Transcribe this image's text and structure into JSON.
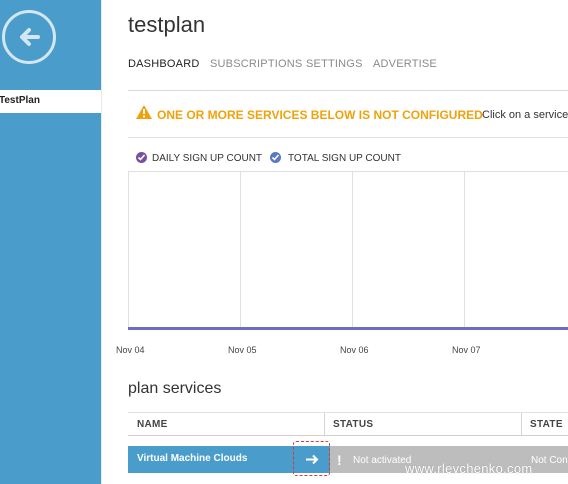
{
  "app": {
    "title": "testplan"
  },
  "sidebar": {
    "back_icon": "back-arrow-icon",
    "selected_item": "TestPlan"
  },
  "tabs": [
    {
      "label": "DASHBOARD",
      "active": true
    },
    {
      "label": "SUBSCRIPTIONS",
      "active": false
    },
    {
      "label": "SETTINGS",
      "active": false
    },
    {
      "label": "ADVERTISE",
      "active": false
    }
  ],
  "warning": {
    "icon": "warning-triangle-icon",
    "message": "ONE OR MORE SERVICES BELOW IS NOT CONFIGURED",
    "hint": "Click on a service",
    "color": "#f0a20b"
  },
  "legend": [
    {
      "label": "DAILY SIGN UP COUNT",
      "color": "#7b4f9c"
    },
    {
      "label": "TOTAL SIGN UP COUNT",
      "color": "#5a79c4"
    }
  ],
  "chart_data": {
    "type": "line",
    "categories": [
      "Nov 04",
      "Nov 05",
      "Nov 06",
      "Nov 07"
    ],
    "series": [
      {
        "name": "DAILY SIGN UP COUNT",
        "values": [
          0,
          0,
          0,
          0
        ]
      },
      {
        "name": "TOTAL SIGN UP COUNT",
        "values": [
          0,
          0,
          0,
          0
        ]
      }
    ],
    "grid": true
  },
  "services": {
    "title": "plan services",
    "columns": [
      "NAME",
      "STATUS",
      "STATE"
    ],
    "rows": [
      {
        "name": "Virtual Machine Clouds",
        "status": "Not activated",
        "state": "Not Con"
      }
    ],
    "row_arrow_icon": "arrow-right-icon",
    "status_icon": "exclamation-icon"
  },
  "watermark": "www.rlevchenko.com",
  "colors": {
    "accent": "#4a9ccb",
    "line": "#6d6ec2"
  }
}
